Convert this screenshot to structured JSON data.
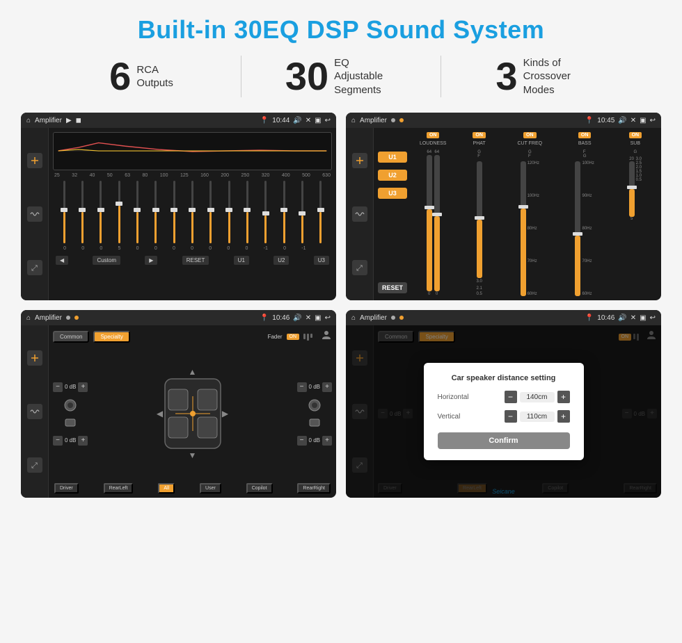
{
  "page": {
    "title": "Built-in 30EQ DSP Sound System",
    "watermark": "Seicane"
  },
  "stats": [
    {
      "number": "6",
      "label": "RCA\nOutputs"
    },
    {
      "number": "30",
      "label": "EQ Adjustable\nSegments"
    },
    {
      "number": "3",
      "label": "Kinds of\nCrossover Modes"
    }
  ],
  "screens": {
    "screen1": {
      "title": "Amplifier",
      "time": "10:44",
      "eq_bands": [
        "25",
        "32",
        "40",
        "50",
        "63",
        "80",
        "100",
        "125",
        "160",
        "200",
        "250",
        "320",
        "400",
        "500",
        "630"
      ],
      "eq_values": [
        "0",
        "0",
        "0",
        "5",
        "0",
        "0",
        "0",
        "0",
        "0",
        "0",
        "0",
        "-1",
        "0",
        "-1"
      ],
      "buttons": [
        "Custom",
        "RESET",
        "U1",
        "U2",
        "U3"
      ]
    },
    "screen2": {
      "title": "Amplifier",
      "time": "10:45",
      "channels": [
        "LOUDNESS",
        "PHAT",
        "CUT FREQ",
        "BASS",
        "SUB"
      ],
      "u_buttons": [
        "U1",
        "U2",
        "U3"
      ],
      "reset_label": "RESET"
    },
    "screen3": {
      "title": "Amplifier",
      "time": "10:46",
      "tabs": [
        "Common",
        "Specialty"
      ],
      "fader_label": "Fader",
      "fader_on": "ON",
      "buttons": [
        "Driver",
        "RearLeft",
        "All",
        "User",
        "Copilot",
        "RearRight"
      ],
      "db_values": [
        "0 dB",
        "0 dB",
        "0 dB",
        "0 dB"
      ]
    },
    "screen4": {
      "title": "Amplifier",
      "time": "10:46",
      "tabs": [
        "Common",
        "Specialty"
      ],
      "dialog": {
        "title": "Car speaker distance setting",
        "horizontal_label": "Horizontal",
        "horizontal_value": "140cm",
        "vertical_label": "Vertical",
        "vertical_value": "110cm",
        "confirm_label": "Confirm"
      },
      "buttons": [
        "Driver",
        "RearLeft",
        "Copilot",
        "RearRight"
      ],
      "db_values": [
        "0 dB",
        "0 dB"
      ]
    }
  },
  "icons": {
    "home": "⌂",
    "back": "↩",
    "pin": "📍",
    "speaker": "🔊",
    "close": "✕",
    "window": "▣",
    "play": "▶",
    "pause": "◀",
    "chevron_right": "»",
    "person": "👤",
    "settings": "⚙"
  }
}
